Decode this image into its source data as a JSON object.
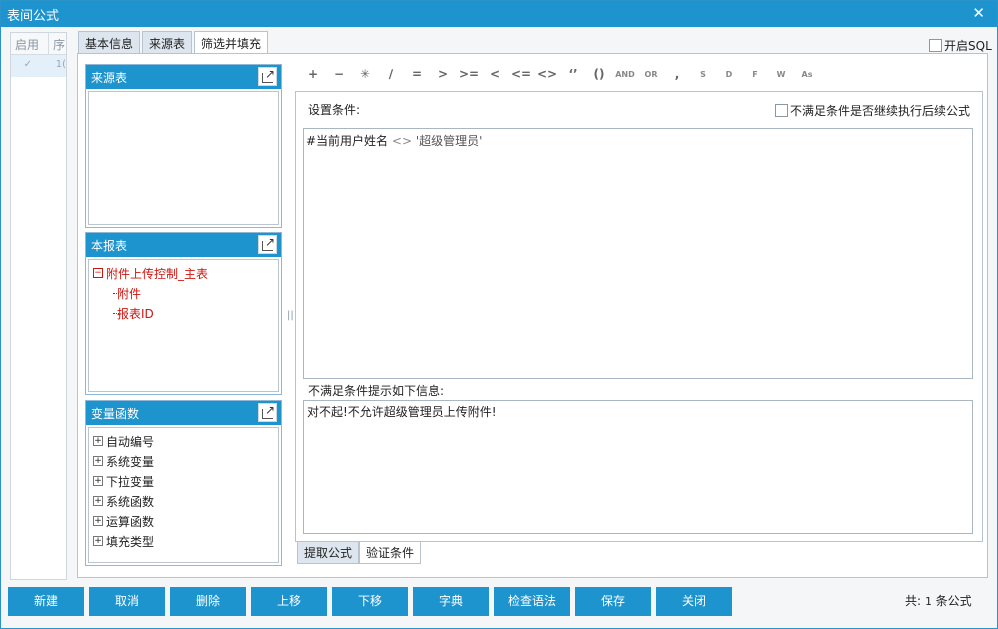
{
  "window": {
    "title": "表间公式",
    "close_icon": "✕"
  },
  "list": {
    "headers": [
      "启用",
      "序"
    ],
    "rows": [
      {
        "enabled_mark": "✓",
        "index": "1("
      }
    ]
  },
  "tabs": [
    "基本信息",
    "来源表",
    "筛选并填充"
  ],
  "sql_toggle_label": "开启SQL",
  "panels": {
    "source": {
      "title": "来源表"
    },
    "report": {
      "title": "本报表",
      "root": "附件上传控制_主表",
      "children": [
        "附件",
        "报表ID"
      ]
    },
    "functions": {
      "title": "变量函数",
      "items": [
        "自动编号",
        "系统变量",
        "下拉变量",
        "系统函数",
        "运算函数",
        "填充类型"
      ]
    }
  },
  "operators": [
    "+",
    "−",
    "✳",
    "∕",
    "=",
    ">",
    ">=",
    "<",
    "<=",
    "<>",
    "‘’",
    "()",
    "AND",
    "OR",
    ",",
    "S",
    "D",
    "F",
    "W",
    "As"
  ],
  "condition": {
    "label": "设置条件:",
    "continue_label": "不满足条件是否继续执行后续公式",
    "expr_field": "#当前用户姓名",
    "expr_op": "<>",
    "expr_value": "'超级管理员'"
  },
  "message": {
    "label": "不满足条件提示如下信息:",
    "text": "对不起!不允许超级管理员上传附件!"
  },
  "bottom_tabs": [
    "提取公式",
    "验证条件"
  ],
  "buttons": [
    "新建",
    "取消",
    "删除",
    "上移",
    "下移",
    "字典",
    "检查语法",
    "保存",
    "关闭"
  ],
  "summary": {
    "prefix": "共:",
    "count": "1",
    "suffix": "条公式"
  },
  "colors": {
    "accent": "#1e94cf",
    "tree_red": "#d0150f"
  }
}
